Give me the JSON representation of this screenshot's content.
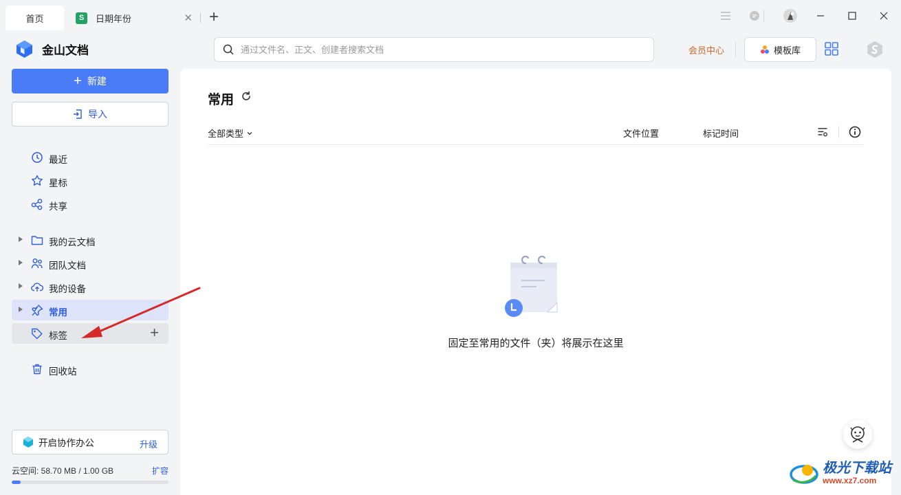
{
  "tabs": [
    {
      "label": "首页",
      "active": true
    },
    {
      "label": "日期年份",
      "icon": "spreadsheet-icon",
      "badge": "S"
    }
  ],
  "app": {
    "name": "金山文档"
  },
  "search": {
    "placeholder": "通过文件名、正文、创建者搜索文档"
  },
  "header": {
    "vip_label": "会员中心",
    "template_label": "模板库"
  },
  "sidebar": {
    "new_label": "新建",
    "import_label": "导入",
    "items": [
      {
        "label": "最近",
        "icon": "clock-icon"
      },
      {
        "label": "星标",
        "icon": "star-icon"
      },
      {
        "label": "共享",
        "icon": "share-icon"
      },
      {
        "label": "我的云文档",
        "icon": "folder-icon",
        "expandable": true
      },
      {
        "label": "团队文档",
        "icon": "team-icon",
        "expandable": true
      },
      {
        "label": "我的设备",
        "icon": "cloud-upload-icon",
        "expandable": true
      },
      {
        "label": "常用",
        "icon": "pin-icon",
        "expandable": true,
        "active": true
      },
      {
        "label": "标签",
        "icon": "tag-icon"
      },
      {
        "label": "回收站",
        "icon": "trash-icon"
      }
    ],
    "collab_label": "开启协作办公",
    "upgrade_label": "升级",
    "storage_text": "云空间: 58.70 MB / 1.00 GB",
    "storage_used_fraction": 0.057,
    "expand_label": "扩容"
  },
  "main": {
    "title": "常用",
    "filter_label": "全部类型",
    "col_location": "文件位置",
    "col_marked_time": "标记时间",
    "empty_text": "固定至常用的文件（夹）将展示在这里"
  },
  "watermark": {
    "title": "极光下载站",
    "url": "www.xz7.com"
  },
  "colors": {
    "accent": "#4a7cf7",
    "vip": "#d0682b",
    "annotation_arrow": "#d42a2a"
  }
}
